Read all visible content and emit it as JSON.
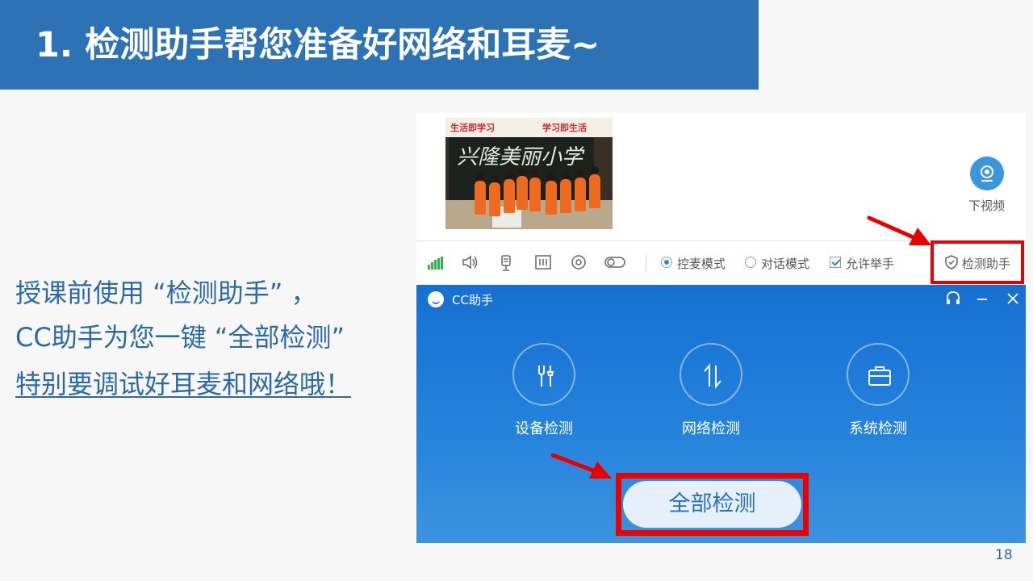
{
  "slide": {
    "title": "1. 检测助手帮您准备好网络和耳麦~",
    "body_line1": "授课前使用 “检测助手” ，",
    "body_line2": "CC助手为您一键 “全部检测”",
    "body_line3": "特别要调试好耳麦和网络哦！",
    "page_number": "18"
  },
  "video_panel": {
    "photo_banner_left": "生活即学习",
    "photo_banner_right": "学习即生活",
    "photo_board_text": "兴隆美丽小学",
    "camera_button_label": "下视频",
    "toolbar": {
      "mode_raise": "控麦模式",
      "mode_dialog": "对话模式",
      "allow_hand": "允许举手",
      "helper": "检测助手"
    }
  },
  "cc_window": {
    "title": "CC助手",
    "features": [
      {
        "label": "设备检测",
        "icon": "tools-icon"
      },
      {
        "label": "网络检测",
        "icon": "network-arrows-icon"
      },
      {
        "label": "系统检测",
        "icon": "briefcase-icon"
      }
    ],
    "all_check_button": "全部检测"
  },
  "colors": {
    "title_bar": "#2e72b6",
    "body_text": "#2d6aa5",
    "cc_window": "#1670d2",
    "highlight_red": "#ea0000",
    "signal_green": "#2fb34a"
  }
}
